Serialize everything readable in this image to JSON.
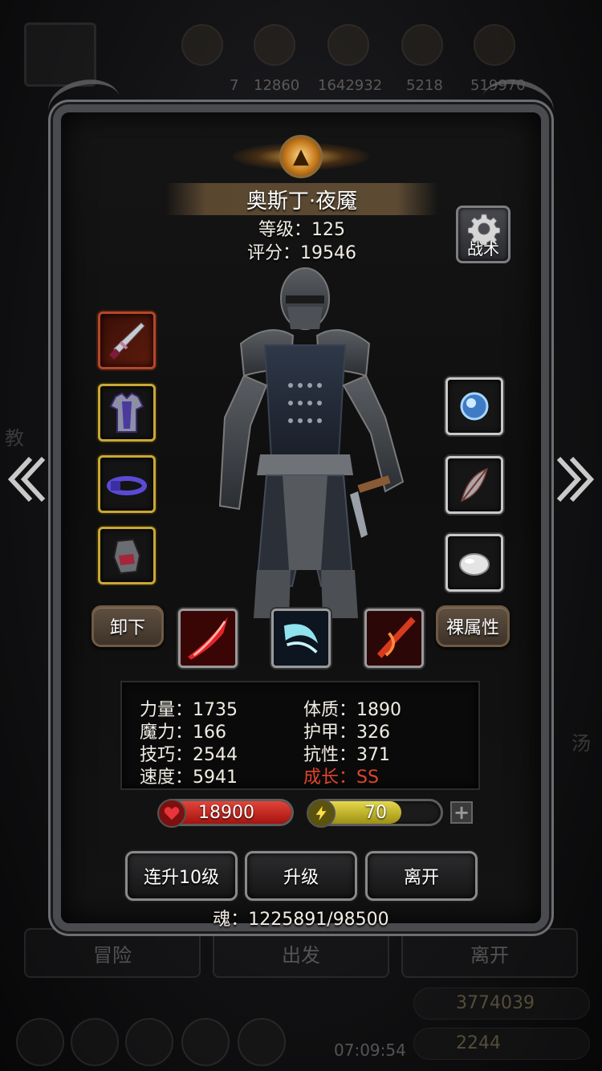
{
  "background": {
    "resources": [
      "7",
      "12860",
      "1642932",
      "5218",
      "519970"
    ],
    "bottom_tabs": [
      "冒险",
      "出发",
      "离开"
    ],
    "gold": "3774039",
    "gems": "2244",
    "clock": "07:09:54",
    "side_left": "教",
    "side_right": "汤"
  },
  "hero": {
    "name": "奥斯丁·夜魇",
    "level": "等级：125",
    "score": "评分：19546"
  },
  "tactics_button": {
    "label": "战术",
    "icon": "gear-icon"
  },
  "equipment": {
    "left": [
      {
        "name": "weapon",
        "icon": "sword-icon",
        "frame": "red"
      },
      {
        "name": "armor",
        "icon": "chest-armor-icon",
        "frame": "gold"
      },
      {
        "name": "belt",
        "icon": "belt-icon",
        "frame": "gold"
      },
      {
        "name": "gloves",
        "icon": "gauntlet-icon",
        "frame": "gold"
      }
    ],
    "right": [
      {
        "name": "orb",
        "icon": "orb-icon",
        "frame": "silver"
      },
      {
        "name": "feather",
        "icon": "feather-icon",
        "frame": "silver"
      },
      {
        "name": "stone",
        "icon": "stone-icon",
        "frame": "silver"
      }
    ]
  },
  "buttons": {
    "unequip": "卸下",
    "base_stats": "裸属性",
    "level_up_10": "连升10级",
    "level_up": "升级",
    "leave": "离开"
  },
  "skills": [
    {
      "name": "blood-slash",
      "icon": "red-slash-icon"
    },
    {
      "name": "frost-crescent",
      "icon": "blue-crescent-icon"
    },
    {
      "name": "fire-blade",
      "icon": "fire-blade-icon"
    }
  ],
  "stats": {
    "strength": "力量：1735",
    "constitution": "体质：1890",
    "magic": "魔力：166",
    "armor": "护甲：326",
    "skill": "技巧：2544",
    "resistance": "抗性：371",
    "speed": "速度：5941",
    "growth": "成长：SS"
  },
  "hp_bar": {
    "value": "18900",
    "fill_fraction": 1.0,
    "color": "#c8231b"
  },
  "energy_bar": {
    "value": "70",
    "fill_fraction": 0.7,
    "color": "#c4b820"
  },
  "soul": "魂：1225891/98500",
  "colors": {
    "growth": "#e0452b",
    "gold_frame": "#c9a837",
    "red_frame": "#b5472a"
  }
}
